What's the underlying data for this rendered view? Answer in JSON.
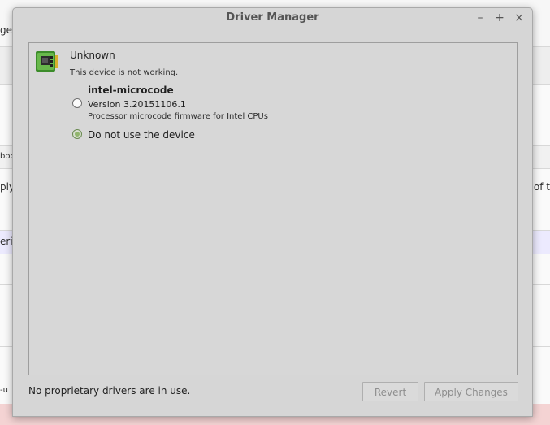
{
  "background": {
    "left_text_fragments": [
      "gen",
      "boo",
      "ply",
      "eri",
      "-u"
    ],
    "right_text_fragments": [
      "of t"
    ],
    "bottom_band_color": "#f4d3d3",
    "highlight_band_color": "#eceafe"
  },
  "dialog": {
    "title": "Driver Manager",
    "window_controls": [
      "minimize-icon",
      "maximize-icon",
      "close-icon"
    ],
    "window_control_glyphs": {
      "minimize": "–",
      "maximize": "+",
      "close": "×"
    },
    "device": {
      "name": "Unknown",
      "status": "This device is not working.",
      "icon": "chip-icon"
    },
    "driver_option": {
      "name": "intel-microcode",
      "version": "Version 3.20151106.1",
      "description": "Processor microcode firmware for Intel CPUs",
      "selected": false
    },
    "no_driver_option": {
      "label": "Do not use the device",
      "selected": true
    },
    "footer": {
      "status": "No proprietary drivers are in use.",
      "revert_label": "Revert",
      "apply_label": "Apply Changes",
      "buttons_enabled": false
    }
  }
}
